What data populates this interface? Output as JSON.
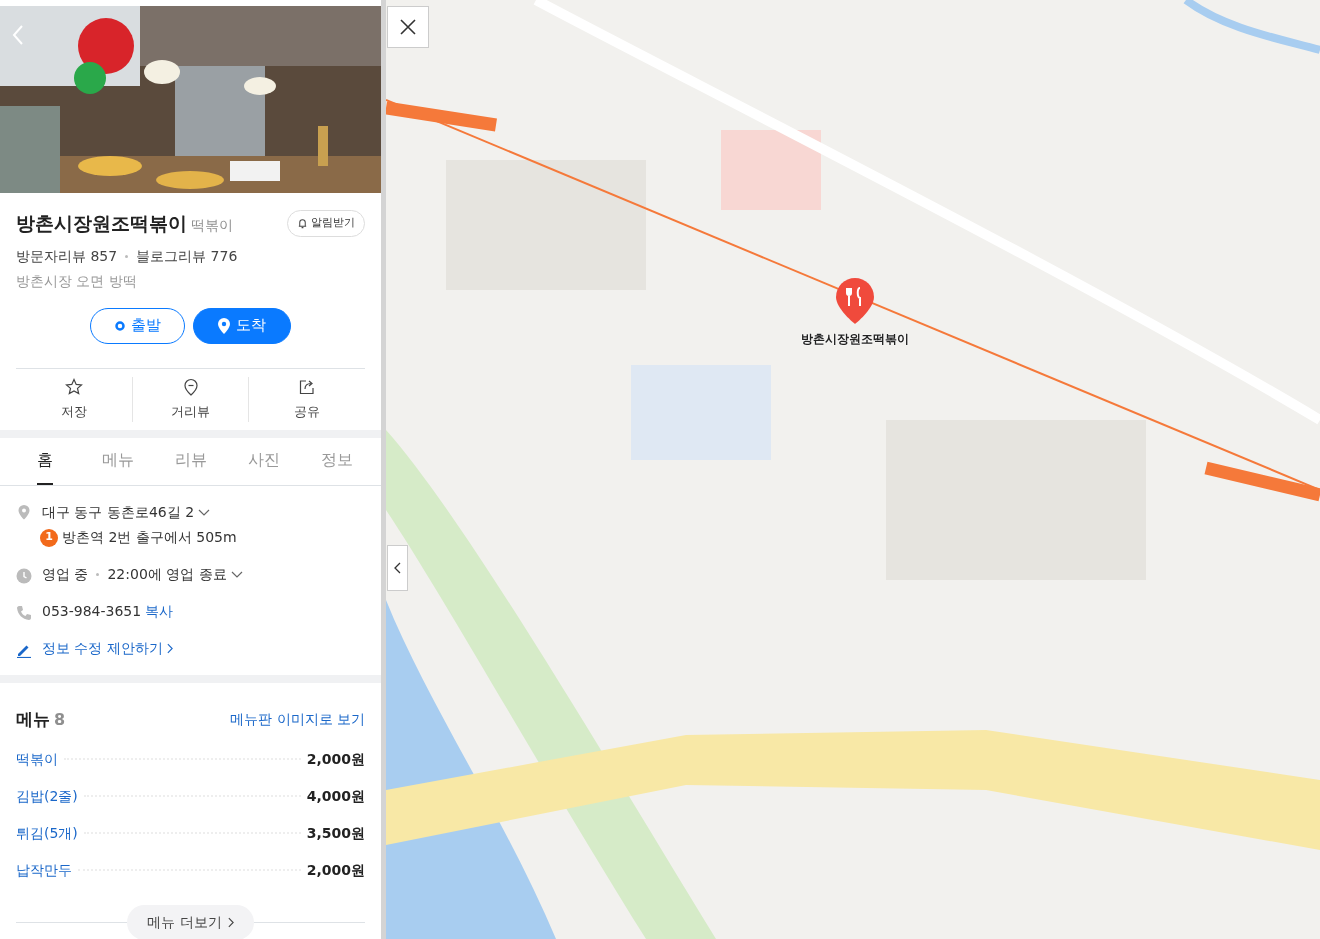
{
  "place": {
    "name": "방촌시장원조떡볶이",
    "category": "떡볶이",
    "alert_button": "알림받기",
    "reviews": [
      "방문자리뷰 857",
      "블로그리뷰 776"
    ],
    "keywords": "방촌시장 오면 방떡"
  },
  "route_buttons": [
    {
      "label": "출발",
      "kind": "origin"
    },
    {
      "label": "도착",
      "kind": "destination"
    }
  ],
  "actions": [
    {
      "label": "저장",
      "kind": "save"
    },
    {
      "label": "거리뷰",
      "kind": "streetview"
    },
    {
      "label": "공유",
      "kind": "share"
    }
  ],
  "tabs": [
    {
      "label": "홈",
      "selected": true
    },
    {
      "label": "메뉴",
      "selected": false
    },
    {
      "label": "리뷰",
      "selected": false
    },
    {
      "label": "사진",
      "selected": false
    },
    {
      "label": "정보",
      "selected": false
    }
  ],
  "info": {
    "address": "대구 동구 동촌로46길 2",
    "subway_line": "1",
    "directions": "방촌역 2번 출구에서 505m",
    "status": "영업 중",
    "hours": "22:00에 영업 종료",
    "phone": "053-984-3651",
    "copy": "복사",
    "suggest": "정보 수정 제안하기"
  },
  "menu": {
    "title": "메뉴",
    "count": "8",
    "image_link": "메뉴판 이미지로 보기",
    "items": [
      {
        "name": "떡볶이",
        "price": "2,000원"
      },
      {
        "name": "김밥(2줄)",
        "price": "4,000원"
      },
      {
        "name": "튀김(5개)",
        "price": "3,500원"
      },
      {
        "name": "납작만두",
        "price": "2,000원"
      }
    ],
    "more": "메뉴 더보기"
  },
  "map": {
    "kind": "picture",
    "marker_label": "방촌시장원조떡볶이"
  }
}
